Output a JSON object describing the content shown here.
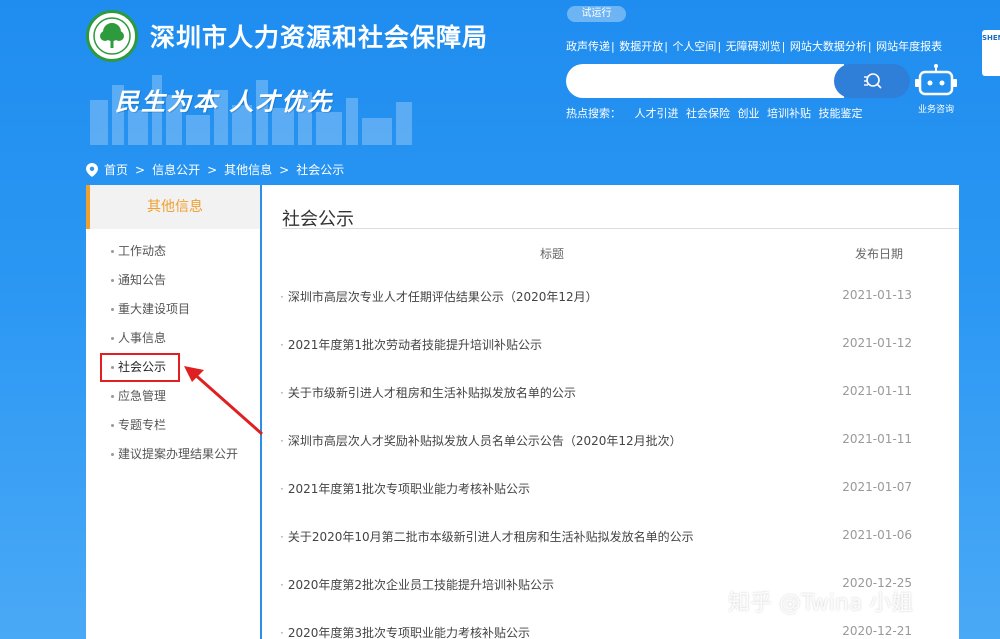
{
  "header": {
    "site_title": "深圳市人力资源和社会保障局",
    "slogan": "民生为本  人才优先",
    "trial_badge": "试运行",
    "top_links": [
      "政声传递",
      "数据开放",
      "个人空间",
      "无障碍浏览",
      "网站大数据分析",
      "网站年度报表"
    ],
    "search_placeholder": "",
    "hot_search_label": "热点搜索：",
    "hot_search_items": [
      "人才引进",
      "社会保险",
      "创业",
      "培训补贴",
      "技能鉴定"
    ],
    "robot_label": "业务咨询",
    "edge_logo_text": "SHEN"
  },
  "breadcrumb": {
    "items": [
      "首页",
      "信息公开",
      "其他信息",
      "社会公示"
    ],
    "separator": ">"
  },
  "sidebar": {
    "heading": "其他信息",
    "items": [
      {
        "label": "工作动态"
      },
      {
        "label": "通知公告"
      },
      {
        "label": "重大建设项目"
      },
      {
        "label": "人事信息"
      },
      {
        "label": "社会公示"
      },
      {
        "label": "应急管理"
      },
      {
        "label": "专题专栏"
      },
      {
        "label": "建议提案办理结果公开"
      }
    ],
    "active_index": 4
  },
  "content": {
    "title": "社会公示",
    "col_title": "标题",
    "col_date": "发布日期",
    "rows": [
      {
        "title": "深圳市高层次专业人才任期评估结果公示（2020年12月）",
        "date": "2021-01-13"
      },
      {
        "title": "2021年度第1批次劳动者技能提升培训补贴公示",
        "date": "2021-01-12"
      },
      {
        "title": "关于市级新引进人才租房和生活补贴拟发放名单的公示",
        "date": "2021-01-11"
      },
      {
        "title": "深圳市高层次人才奖励补贴拟发放人员名单公示公告（2020年12月批次）",
        "date": "2021-01-11"
      },
      {
        "title": "2021年度第1批次专项职业能力考核补贴公示",
        "date": "2021-01-07"
      },
      {
        "title": "关于2020年10月第二批市本级新引进人才租房和生活补贴拟发放名单的公示",
        "date": "2021-01-06"
      },
      {
        "title": "2020年度第2批次企业员工技能提升培训补贴公示",
        "date": "2020-12-25"
      },
      {
        "title": "2020年度第3批次专项职业能力考核补贴公示",
        "date": "2020-12-21"
      }
    ]
  },
  "watermark": "知乎 @Twina 小姐",
  "colors": {
    "background": "#2b97f3",
    "accent_orange": "#f0a030",
    "highlight_red": "#e02020"
  }
}
